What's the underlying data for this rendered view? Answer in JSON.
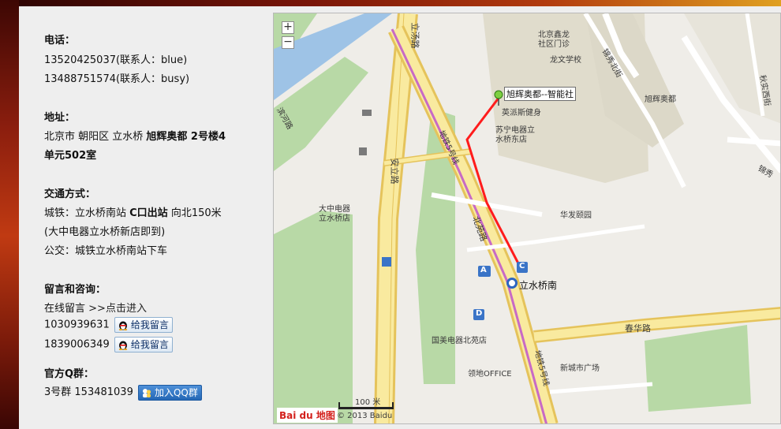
{
  "contact": {
    "phone_heading": "电话：",
    "phone1": "13520425037(联系人：blue)",
    "phone2": "13488751574(联系人：busy)",
    "address_heading": "地址：",
    "address_plain": "北京市 朝阳区 立水桥 ",
    "address_bold1": "旭辉奥都 2号楼4",
    "address_bold2": "单元502室",
    "transport_heading": "交通方式：",
    "transport_l1_a": "城铁：立水桥南站 ",
    "transport_l1_b": "C口出站",
    "transport_l1_c": " 向北150米",
    "transport_l2": "(大中电器立水桥新店即到)",
    "transport_l3": "公交：城铁立水桥南站下车",
    "message_heading": "留言和咨询：",
    "online_msg": "在线留言",
    "online_link": ">>点击进入",
    "qq1": "1030939631",
    "qq2": "1839006349",
    "qq_btn": "给我留言",
    "group_heading": "官方Q群：",
    "group_text": "3号群 153481039",
    "group_btn": "加入QQ群"
  },
  "map": {
    "zoom_in": "+",
    "zoom_out": "−",
    "marker_label": "旭辉奥都--智能社",
    "station": "立水桥南",
    "scale": "100 米",
    "copyright": "© 2013 Baidu",
    "logo": "Bai du 地图",
    "labels": {
      "litang_road": "立汤路",
      "anli_road": "安立路",
      "beiyuan_road": "北苑路",
      "chunhua_road": "春华路",
      "metro5_a": "地铁5号线",
      "metro5_b": "地铁5号线",
      "xinlong": "北京鑫龙",
      "xinlong2": "社区门诊",
      "longwen": "龙文学校",
      "xuhui_top": "旭辉奥都",
      "xuhui_right": "旭辉奥都",
      "yingpai": "英派斯健身",
      "suning1": "苏宁电器立",
      "suning2": "水桥东店",
      "dazhong1": "大中电器",
      "dazhong2": "立水桥店",
      "huafa": "华发颐园",
      "guomei": "国美电器北苑店",
      "lingdi": "领地OFFICE",
      "xincheng": "新城市广场",
      "jinxiu_north": "锦秀北街",
      "lingxiu_west": "秋实西街",
      "jinxiu": "锦秀",
      "bin_he": "滨河路",
      "station_a": "A",
      "station_c": "C",
      "station_d": "D"
    }
  }
}
